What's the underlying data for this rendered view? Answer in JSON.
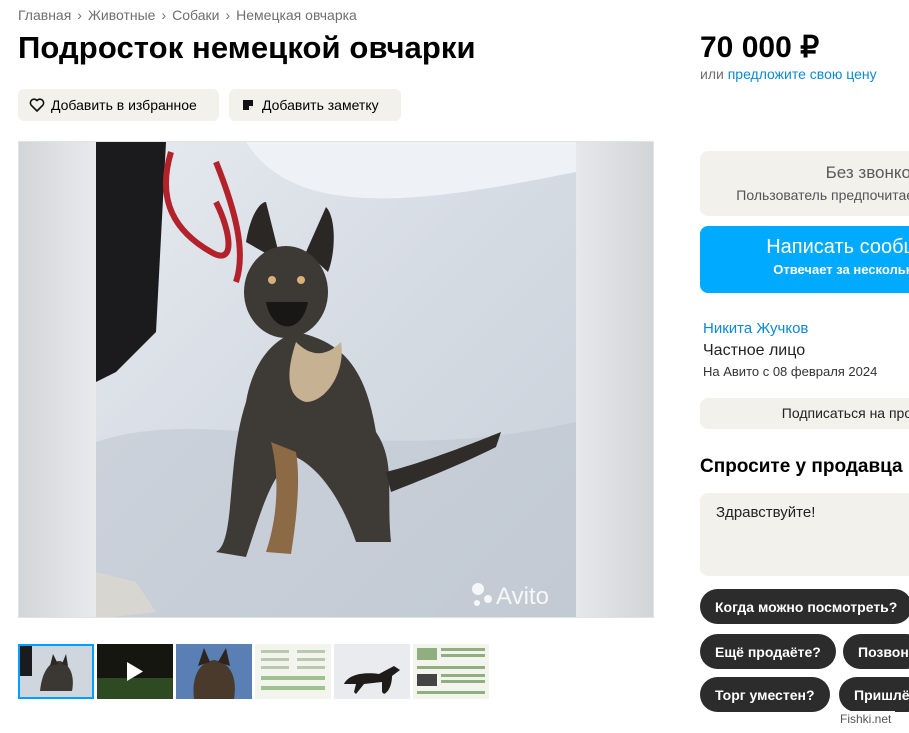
{
  "breadcrumbs": [
    "Главная",
    "Животные",
    "Собаки",
    "Немецкая овчарка"
  ],
  "title": "Подросток немецкой овчарки",
  "actions": {
    "favorite_label": "Добавить в избранное",
    "note_label": "Добавить заметку"
  },
  "price": {
    "amount": "70 000 ₽",
    "prefix": "или",
    "offer_link": "предложите свою цену"
  },
  "gallery": {
    "watermark": "Avito",
    "thumbnail_count": 6,
    "selected_index": 0
  },
  "contact": {
    "no_calls_title": "Без звонков",
    "no_calls_text": "Пользователь предпочитает",
    "write_button": "Написать сообщ",
    "write_subtext": "Отвечает за несколько"
  },
  "seller": {
    "name": "Никита Жучков",
    "type": "Частное лицо",
    "since": "На Авито с 08 февраля 2024",
    "subscribe_label": "Подписаться на прод"
  },
  "ask": {
    "title": "Спросите у продавца",
    "message_value": "Здравствуйте!",
    "chips": [
      "Когда можно посмотреть?",
      "Ещё продаёте?",
      "Позвон",
      "Торг уместен?",
      "Пришлё"
    ]
  },
  "site_watermark": "Fishki.net",
  "colors": {
    "accent": "#00aaff",
    "link": "#0a8ad6",
    "chip_bg": "#2c2c2c",
    "card_bg": "#f2f1ec"
  }
}
